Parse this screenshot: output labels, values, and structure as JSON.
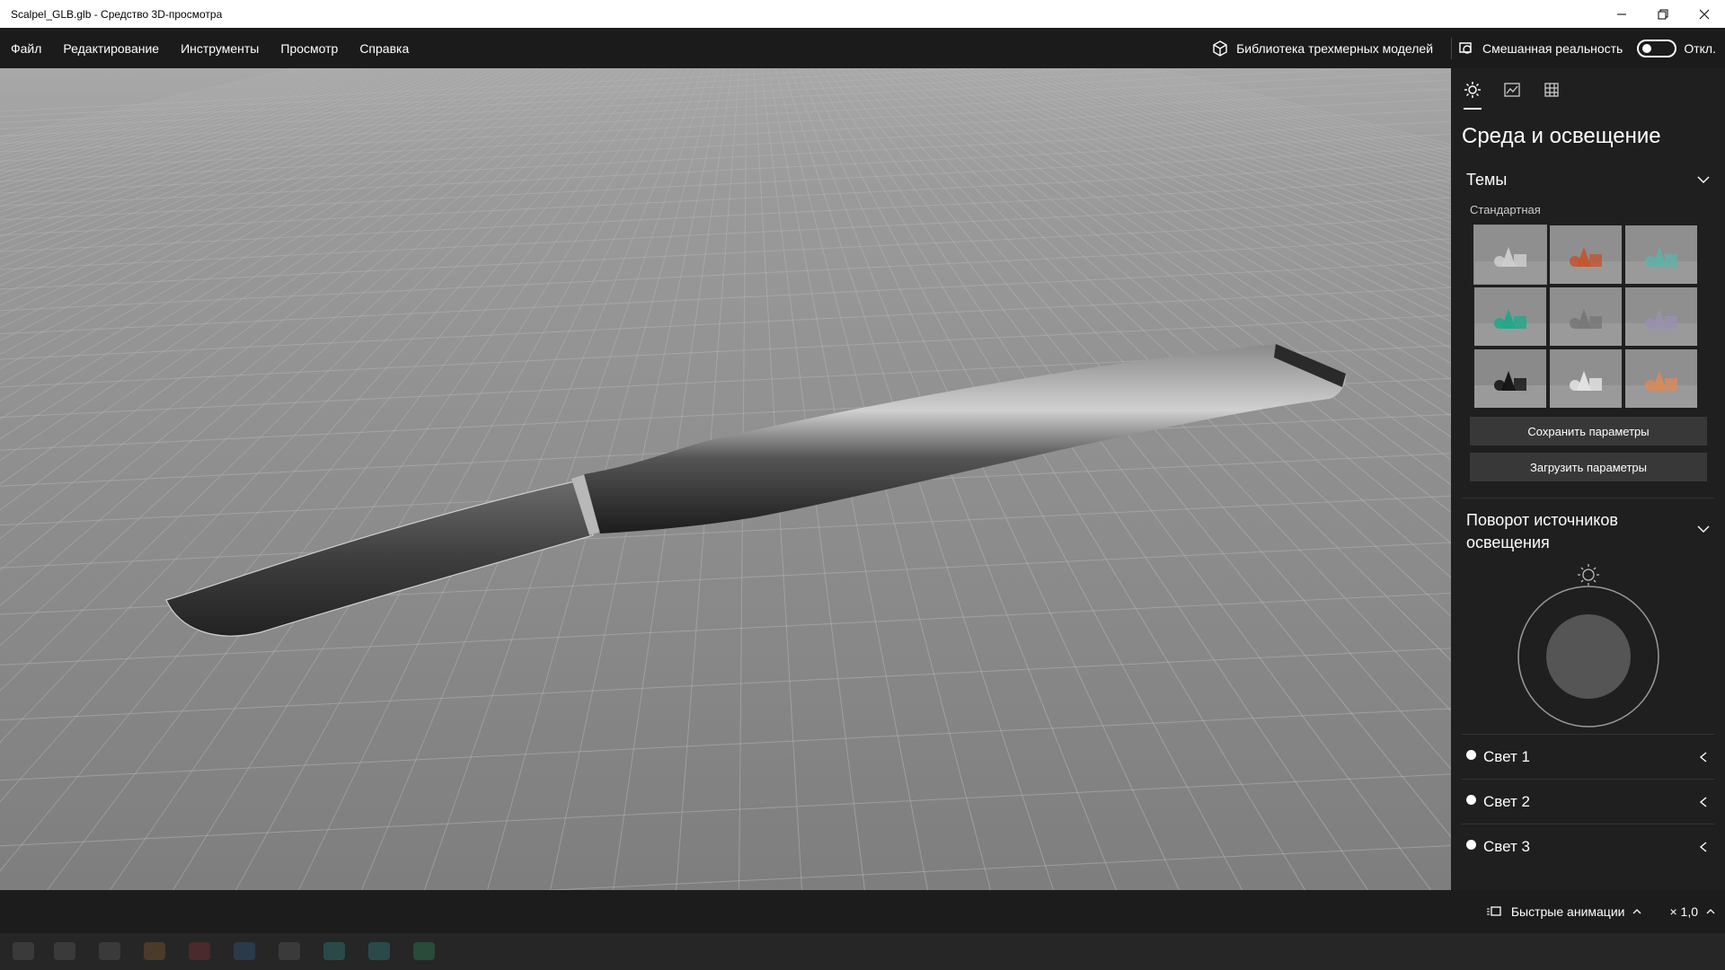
{
  "window": {
    "title": "Scalpel_GLB.glb - Средство 3D-просмотра"
  },
  "menu": {
    "items": [
      "Файл",
      "Редактирование",
      "Инструменты",
      "Просмотр",
      "Справка"
    ],
    "library_label": "Библиотека трехмерных моделей",
    "mixed_reality_label": "Смешанная реальность",
    "mixed_reality_state": "Откл."
  },
  "panel": {
    "title": "Среда и освещение",
    "themes_label": "Темы",
    "themes_subheading": "Стандартная",
    "themes": [
      {
        "name": "white-shapes",
        "color": "#cfcfcf"
      },
      {
        "name": "red-shapes",
        "color": "#c2552e"
      },
      {
        "name": "teal-shapes",
        "color": "#5fb2a8"
      },
      {
        "name": "green-shapes",
        "color": "#1fa88a"
      },
      {
        "name": "grey-shapes",
        "color": "#777777"
      },
      {
        "name": "lavender-shapes",
        "color": "#9a90b0"
      },
      {
        "name": "black-shapes",
        "color": "#111111"
      },
      {
        "name": "white-shapes-2",
        "color": "#e6e6e6"
      },
      {
        "name": "orange-blue-shapes",
        "color": "#d98a5a"
      }
    ],
    "save_label": "Сохранить параметры",
    "load_label": "Загрузить параметры",
    "rotation_label": "Поворот источников освещения",
    "lights": [
      "Свет 1",
      "Свет 2",
      "Свет 3"
    ]
  },
  "status": {
    "animations_label": "Быстрые анимации",
    "speed": "× 1,0"
  }
}
